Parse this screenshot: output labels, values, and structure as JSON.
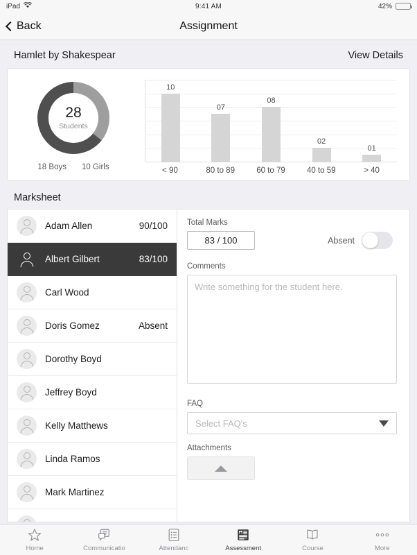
{
  "status_bar": {
    "device": "iPad",
    "wifi_icon": "wifi-icon",
    "time": "9:41 AM",
    "battery_percent": "42%",
    "battery_level": 42,
    "battery_color": "#4cd964"
  },
  "nav": {
    "back_label": "Back",
    "back_icon": "chevron-left-icon",
    "title": "Assignment"
  },
  "assignment": {
    "section_title": "Hamlet by Shakespear",
    "view_details_label": "View Details"
  },
  "chart_data": [
    {
      "type": "pie",
      "title": "",
      "center_value": "28",
      "center_label": "Students",
      "labels": [
        "Boys",
        "Girls"
      ],
      "values": [
        18,
        10
      ],
      "colors": [
        "#4f4f4f",
        "#9e9e9e"
      ],
      "legend": [
        "18 Boys",
        "10 Girls"
      ],
      "legend_position": "bottom"
    },
    {
      "type": "bar",
      "title": "",
      "categories": [
        "< 90",
        "80 to 89",
        "60 to 79",
        "40 to 59",
        "> 40"
      ],
      "values": [
        10,
        7,
        8,
        2,
        1
      ],
      "value_labels": [
        "10",
        "07",
        "08",
        "02",
        "01"
      ],
      "xlabel": "",
      "ylabel": "",
      "ylim": [
        0,
        12
      ],
      "grid": true,
      "gridlines": 6,
      "bar_color": "#d5d5d5"
    }
  ],
  "marksheet": {
    "section_title": "Marksheet",
    "students": [
      {
        "name": "Adam Allen",
        "mark": "90/100",
        "selected": false
      },
      {
        "name": "Albert Gilbert",
        "mark": "83/100",
        "selected": true
      },
      {
        "name": "Carl Wood",
        "mark": "",
        "selected": false
      },
      {
        "name": "Doris Gomez",
        "mark": "Absent",
        "selected": false
      },
      {
        "name": "Dorothy Boyd",
        "mark": "",
        "selected": false
      },
      {
        "name": "Jeffrey Boyd",
        "mark": "",
        "selected": false
      },
      {
        "name": "Kelly Matthews",
        "mark": "",
        "selected": false
      },
      {
        "name": "Linda Ramos",
        "mark": "",
        "selected": false
      },
      {
        "name": "Mark Martinez",
        "mark": "",
        "selected": false
      },
      {
        "name": "",
        "mark": "",
        "selected": false
      }
    ]
  },
  "detail": {
    "total_marks_label": "Total Marks",
    "total_marks_value": "83 / 100",
    "absent_label": "Absent",
    "absent_on": false,
    "comments_label": "Comments",
    "comments_value": "",
    "comments_placeholder": "Write something for the student here.",
    "faq_label": "FAQ",
    "faq_selected": "Select FAQ's",
    "attachments_label": "Attachments",
    "attachment_upload_icon": "upload-arrow-icon"
  },
  "tabbar": {
    "tabs": [
      {
        "label": "Home",
        "icon": "star-icon",
        "active": false
      },
      {
        "label": "Communicatio",
        "icon": "chat-icon",
        "active": false
      },
      {
        "label": "Attendanc",
        "icon": "checklist-icon",
        "active": false
      },
      {
        "label": "Assessment",
        "icon": "assessment-icon",
        "active": true
      },
      {
        "label": "Course",
        "icon": "book-icon",
        "active": false
      },
      {
        "label": "More",
        "icon": "more-dots-icon",
        "active": false
      }
    ]
  }
}
